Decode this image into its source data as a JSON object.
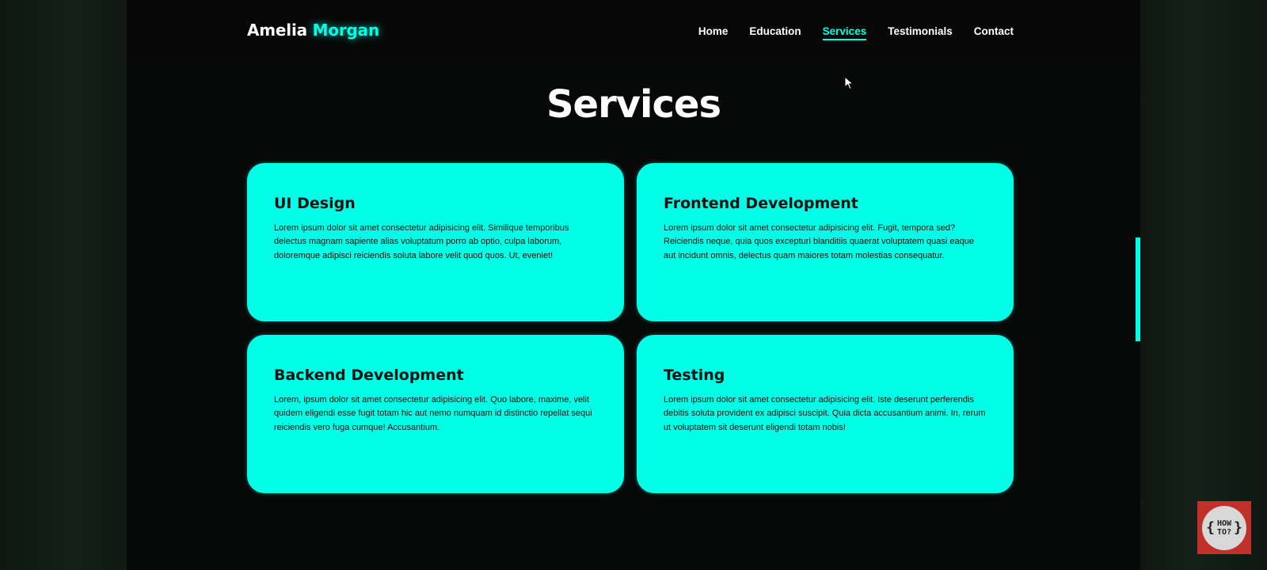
{
  "header": {
    "logo_first": "Amelia",
    "logo_second": "Morgan",
    "nav": [
      {
        "label": "Home",
        "active": false
      },
      {
        "label": "Education",
        "active": false
      },
      {
        "label": "Services",
        "active": true
      },
      {
        "label": "Testimonials",
        "active": false
      },
      {
        "label": "Contact",
        "active": false
      }
    ]
  },
  "services": {
    "title": "Services",
    "cards": [
      {
        "title": "UI Design",
        "text": "Lorem ipsum dolor sit amet consectetur adipisicing elit. Similique temporibus delectus magnam sapiente alias voluptatum porro ab optio, culpa laborum, doloremque adipisci reiciendis soluta labore velit quod quos. Ut, eveniet!"
      },
      {
        "title": "Frontend Development",
        "text": "Lorem ipsum dolor sit amet consectetur adipisicing elit. Fugit, tempora sed? Reiciendis neque, quia quos excepturi blanditiis quaerat voluptatem quasi eaque aut incidunt omnis, delectus quam maiores totam molestias consequatur."
      },
      {
        "title": "Backend Development",
        "text": "Lorem, ipsum dolor sit amet consectetur adipisicing elit. Quo labore, maxime, velit quidem eligendi esse fugit totam hic aut nemo numquam id distinctio repellat sequi reiciendis vero fuga cumque! Accusantium."
      },
      {
        "title": "Testing",
        "text": "Lorem ipsum dolor sit amet consectetur adipisicing elit. Iste deserunt perferendis debitis soluta provident ex adipisci suscipit. Quia dicta accusantium animi. In, rerum ut voluptatem sit deserunt eligendi totam nobis!"
      }
    ]
  },
  "badge": {
    "line1": "HOW",
    "line2": "TO?",
    "brace_left": "{",
    "brace_right": "}"
  },
  "colors": {
    "accent": "#00ffe6",
    "background": "#070808",
    "badge_red": "#c0312b"
  },
  "icons": {
    "cursor": "cursor-arrow-icon",
    "badge": "howto-logo-icon"
  }
}
